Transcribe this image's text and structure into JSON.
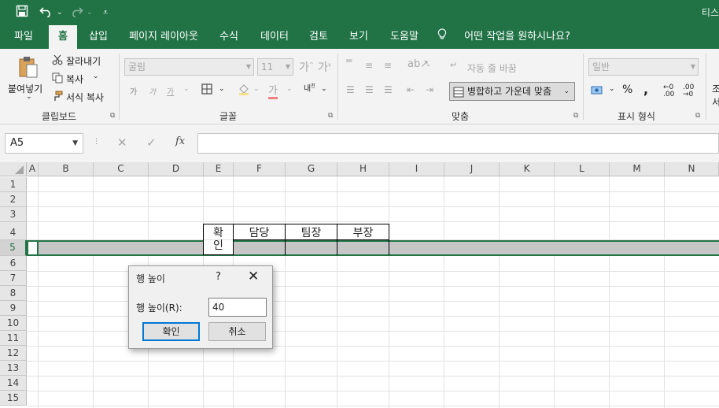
{
  "titlebar": {
    "save_icon": "save-icon",
    "undo_icon": "undo-icon",
    "redo_icon": "redo-icon",
    "title": "티스"
  },
  "tabs": [
    {
      "label": "파일"
    },
    {
      "label": "홈",
      "active": true
    },
    {
      "label": "삽입"
    },
    {
      "label": "페이지 레이아웃"
    },
    {
      "label": "수식"
    },
    {
      "label": "데이터"
    },
    {
      "label": "검토"
    },
    {
      "label": "보기"
    },
    {
      "label": "도움말"
    }
  ],
  "tell_me": "어떤 작업을 원하시나요?",
  "ribbon": {
    "clipboard": {
      "paste": "붙여넣기",
      "cut": "잘라내기",
      "copy": "복사",
      "format_painter": "서식 복사",
      "group_label": "클립보드"
    },
    "font": {
      "font_name": "굴림",
      "font_size": "11",
      "group_label": "글꼴"
    },
    "alignment": {
      "wrap_text": "자동 줄 바꿈",
      "merge_center": "병합하고 가운데 맞춤",
      "group_label": "맞춤"
    },
    "number": {
      "format": "일반",
      "group_label": "표시 형식"
    }
  },
  "formula_bar": {
    "name_box": "A5",
    "fx": "fx"
  },
  "grid": {
    "columns": [
      "A",
      "B",
      "C",
      "D",
      "E",
      "F",
      "G",
      "H",
      "I",
      "J",
      "K",
      "L",
      "M",
      "N"
    ],
    "rows": [
      "1",
      "2",
      "3",
      "4",
      "5",
      "6",
      "7",
      "8",
      "9",
      "10",
      "11",
      "12",
      "13",
      "14",
      "15"
    ],
    "selected_row": "5",
    "cells": {
      "E4": "확",
      "E5": "인",
      "F4": "담당",
      "G4": "팀장",
      "H4": "부장"
    }
  },
  "dialog": {
    "title": "행 높이",
    "help": "?",
    "label": "행 높이(R):",
    "value": "40",
    "ok": "확인",
    "cancel": "취소"
  },
  "colors": {
    "accent": "#217346",
    "selection": "#c6c6c6"
  }
}
